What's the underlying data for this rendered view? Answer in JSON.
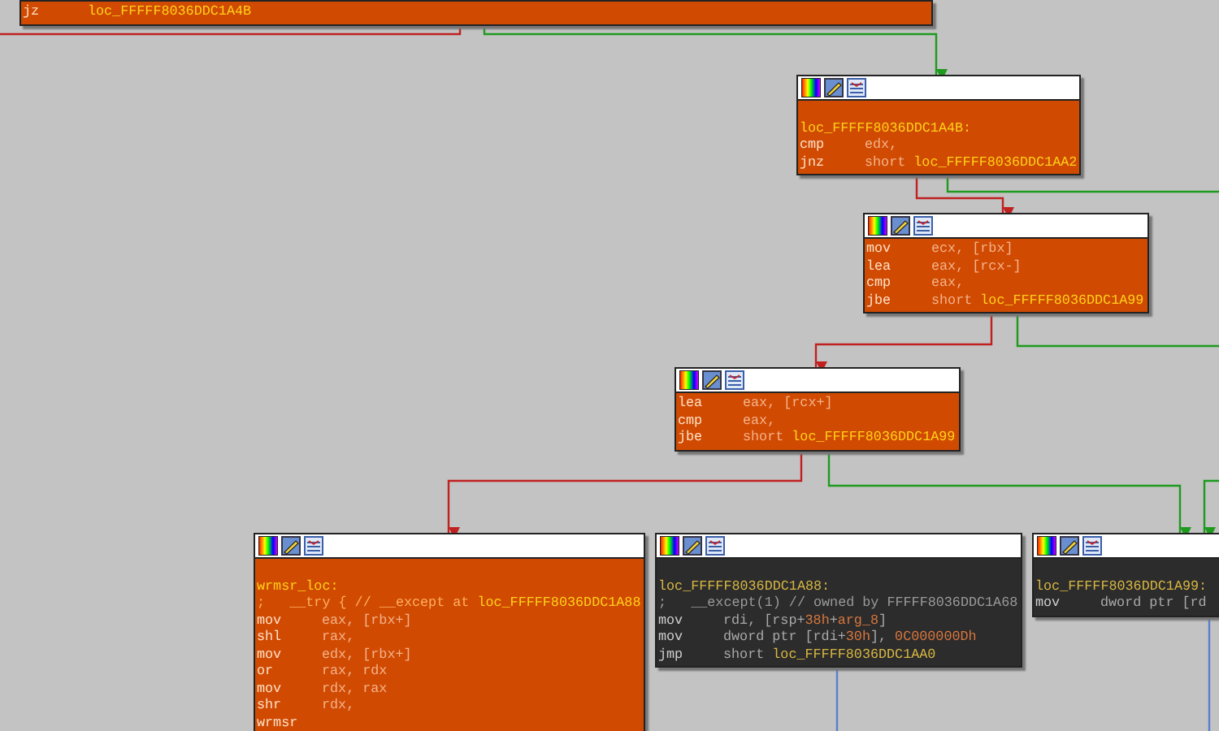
{
  "graph": {
    "nodes": [
      {
        "kind": "orange",
        "header": false,
        "lines": [
          {
            "kind": "code",
            "op": "jz",
            "args": [
              {
                "text": "loc_FFFFF8036DDC1A4B",
                "kind": "label"
              }
            ]
          }
        ]
      },
      {
        "kind": "orange",
        "header": true,
        "lines": [
          {
            "kind": "blank"
          },
          {
            "kind": "text",
            "args": [
              {
                "text": "loc_FFFFF8036DDC1A4B:",
                "kind": "label"
              }
            ]
          },
          {
            "kind": "code",
            "op": "cmp",
            "args": [
              {
                "text": "edx,",
                "kind": "operand"
              }
            ]
          },
          {
            "kind": "code",
            "op": "jnz",
            "args": [
              {
                "text": "short ",
                "kind": "operand"
              },
              {
                "text": "loc_FFFFF8036DDC1AA2",
                "kind": "label"
              }
            ]
          }
        ]
      },
      {
        "kind": "orange",
        "header": true,
        "lines": [
          {
            "kind": "code",
            "op": "mov",
            "args": [
              {
                "text": "ecx, [rbx]",
                "kind": "operand"
              }
            ]
          },
          {
            "kind": "code",
            "op": "lea",
            "args": [
              {
                "text": "eax, [rcx-]",
                "kind": "operand"
              }
            ]
          },
          {
            "kind": "code",
            "op": "cmp",
            "args": [
              {
                "text": "eax,",
                "kind": "operand"
              }
            ]
          },
          {
            "kind": "code",
            "op": "jbe",
            "args": [
              {
                "text": "short ",
                "kind": "operand"
              },
              {
                "text": "loc_FFFFF8036DDC1A99",
                "kind": "label"
              }
            ]
          }
        ]
      },
      {
        "kind": "orange",
        "header": true,
        "lines": [
          {
            "kind": "code",
            "op": "lea",
            "args": [
              {
                "text": "eax, [rcx+]",
                "kind": "operand"
              }
            ]
          },
          {
            "kind": "code",
            "op": "cmp",
            "args": [
              {
                "text": "eax,",
                "kind": "operand"
              }
            ]
          },
          {
            "kind": "code",
            "op": "jbe",
            "args": [
              {
                "text": "short ",
                "kind": "operand"
              },
              {
                "text": "loc_FFFFF8036DDC1A99",
                "kind": "label"
              }
            ]
          }
        ]
      },
      {
        "kind": "orange",
        "header": true,
        "lines": [
          {
            "kind": "blank"
          },
          {
            "kind": "text",
            "args": [
              {
                "text": "wrmsr_loc:",
                "kind": "label"
              }
            ]
          },
          {
            "kind": "text",
            "args": [
              {
                "text": ";   __try { // __except at ",
                "kind": "comment"
              },
              {
                "text": "loc_FFFFF8036DDC1A88",
                "kind": "label"
              }
            ]
          },
          {
            "kind": "code",
            "op": "mov",
            "args": [
              {
                "text": "eax, [rbx+]",
                "kind": "operand"
              }
            ]
          },
          {
            "kind": "code",
            "op": "shl",
            "args": [
              {
                "text": "rax,",
                "kind": "operand"
              }
            ]
          },
          {
            "kind": "code",
            "op": "mov",
            "args": [
              {
                "text": "edx, [rbx+]",
                "kind": "operand"
              }
            ]
          },
          {
            "kind": "code",
            "op": "or",
            "args": [
              {
                "text": "rax, rdx",
                "kind": "operand"
              }
            ]
          },
          {
            "kind": "code",
            "op": "mov",
            "args": [
              {
                "text": "rdx, rax",
                "kind": "operand"
              }
            ]
          },
          {
            "kind": "code",
            "op": "shr",
            "args": [
              {
                "text": "rdx,",
                "kind": "operand"
              }
            ]
          },
          {
            "kind": "code",
            "op": "wrmsr"
          }
        ]
      },
      {
        "kind": "dark",
        "header": true,
        "lines": [
          {
            "kind": "blank"
          },
          {
            "kind": "text",
            "args": [
              {
                "text": "loc_FFFFF8036DDC1A88:",
                "kind": "label"
              }
            ]
          },
          {
            "kind": "text",
            "args": [
              {
                "text": ";   __except(1) // owned by FFFFF8036DDC1A68",
                "kind": "comment"
              }
            ]
          },
          {
            "kind": "code",
            "op": "mov",
            "args": [
              {
                "text": "rdi, [rsp+",
                "kind": "operand"
              },
              {
                "text": "38h",
                "kind": "number"
              },
              {
                "text": "+",
                "kind": "operand"
              },
              {
                "text": "arg_8",
                "kind": "number"
              },
              {
                "text": "]",
                "kind": "operand"
              }
            ]
          },
          {
            "kind": "code",
            "op": "mov",
            "args": [
              {
                "text": "dword ptr [rdi+",
                "kind": "operand"
              },
              {
                "text": "30h",
                "kind": "number"
              },
              {
                "text": "], ",
                "kind": "operand"
              },
              {
                "text": "0C000000Dh",
                "kind": "number"
              }
            ]
          },
          {
            "kind": "code",
            "op": "jmp",
            "args": [
              {
                "text": "short ",
                "kind": "operand"
              },
              {
                "text": "loc_FFFFF8036DDC1AA0",
                "kind": "label"
              }
            ]
          }
        ]
      },
      {
        "kind": "dark",
        "header": true,
        "lines": [
          {
            "kind": "blank"
          },
          {
            "kind": "text",
            "args": [
              {
                "text": "loc_FFFFF8036DDC1A99:",
                "kind": "label"
              }
            ]
          },
          {
            "kind": "code",
            "op": "mov",
            "args": [
              {
                "text": "dword ptr [rd",
                "kind": "operand"
              }
            ]
          }
        ]
      }
    ],
    "edges": [
      {
        "kind": "false"
      },
      {
        "kind": "true"
      },
      {
        "kind": "false"
      },
      {
        "kind": "true"
      },
      {
        "kind": "false"
      },
      {
        "kind": "true"
      },
      {
        "kind": "false"
      },
      {
        "kind": "true"
      },
      {
        "kind": "true"
      },
      {
        "kind": "jump"
      },
      {
        "kind": "jump"
      }
    ]
  }
}
